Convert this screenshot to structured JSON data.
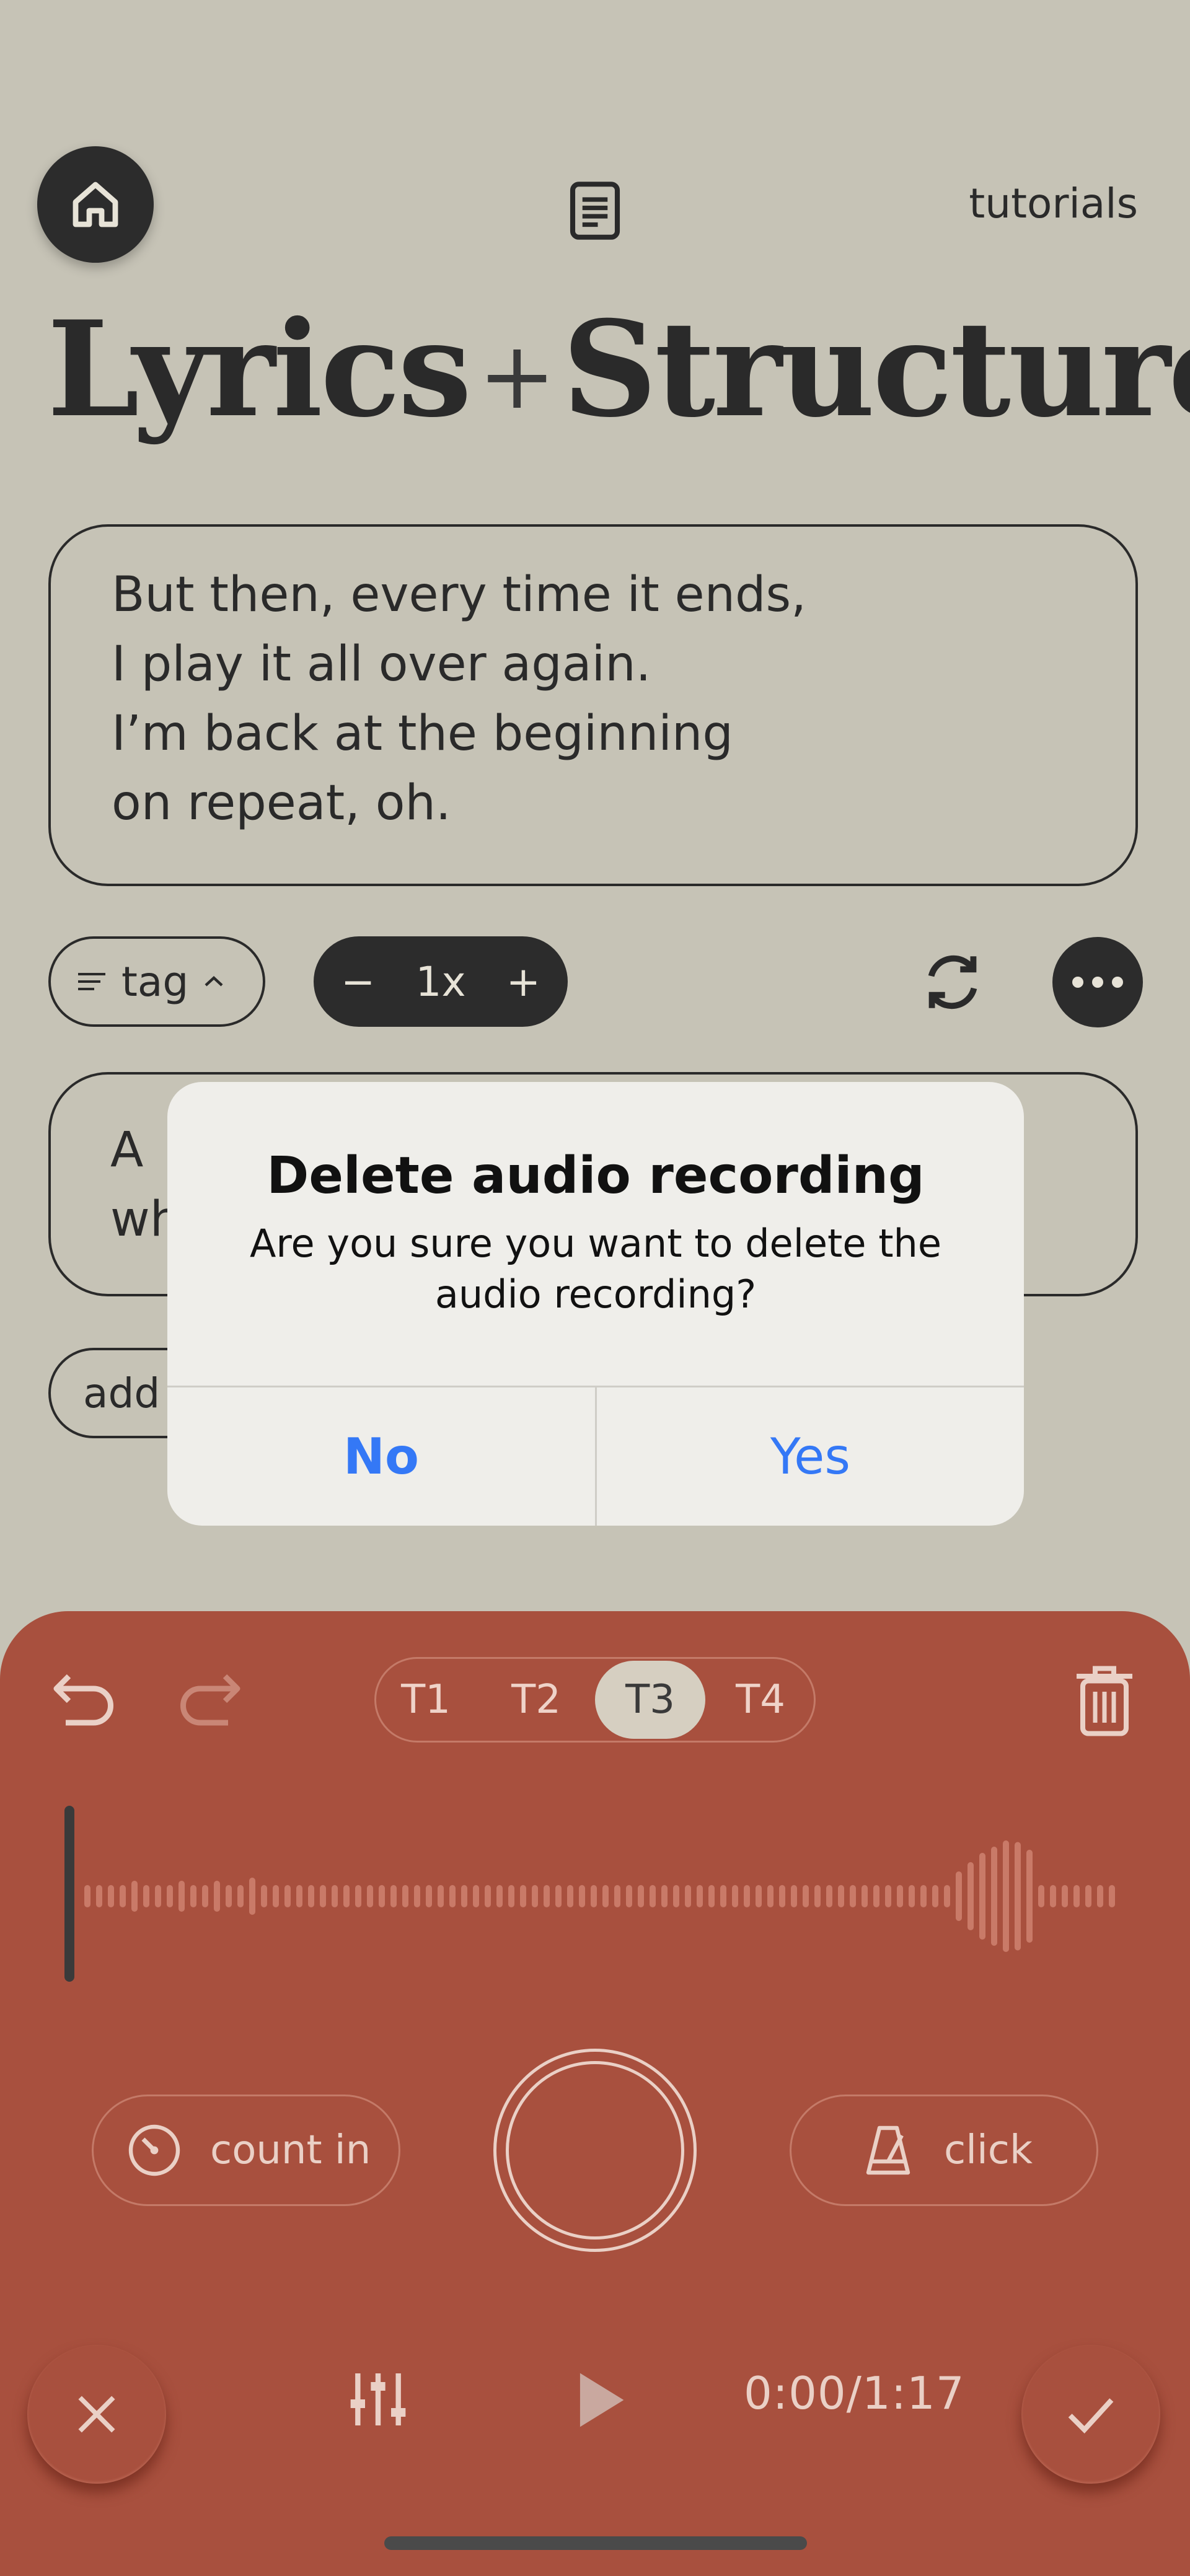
{
  "header": {
    "home_icon": "home-icon",
    "document_icon": "document-icon",
    "tutorials_label": "tutorials",
    "title_left": "Lyrics",
    "title_plus": "+",
    "title_right": "Structure"
  },
  "lyrics": {
    "text": "But then, every time it ends,\nI play it all over again.\nI’m back at the beginning\non repeat, oh."
  },
  "controls": {
    "tag_label": "tag",
    "speed_minus": "−",
    "speed_value": "1x",
    "speed_plus": "+"
  },
  "second_section": {
    "text_partial": "A\nwh"
  },
  "add_label": "add",
  "dialog": {
    "title": "Delete audio recording",
    "message": "Are you sure you want to delete the audio recording?",
    "no_label": "No",
    "yes_label": "Yes"
  },
  "recorder": {
    "tracks": [
      "T1",
      "T2",
      "T3",
      "T4"
    ],
    "active_track": "T3",
    "count_in_label": "count in",
    "click_label": "click",
    "timer": "0:00/1:17"
  },
  "colors": {
    "background": "#c6c3b6",
    "panel": "#a8503e",
    "ink": "#2a2a2a",
    "dialog_button": "#3478f6"
  }
}
